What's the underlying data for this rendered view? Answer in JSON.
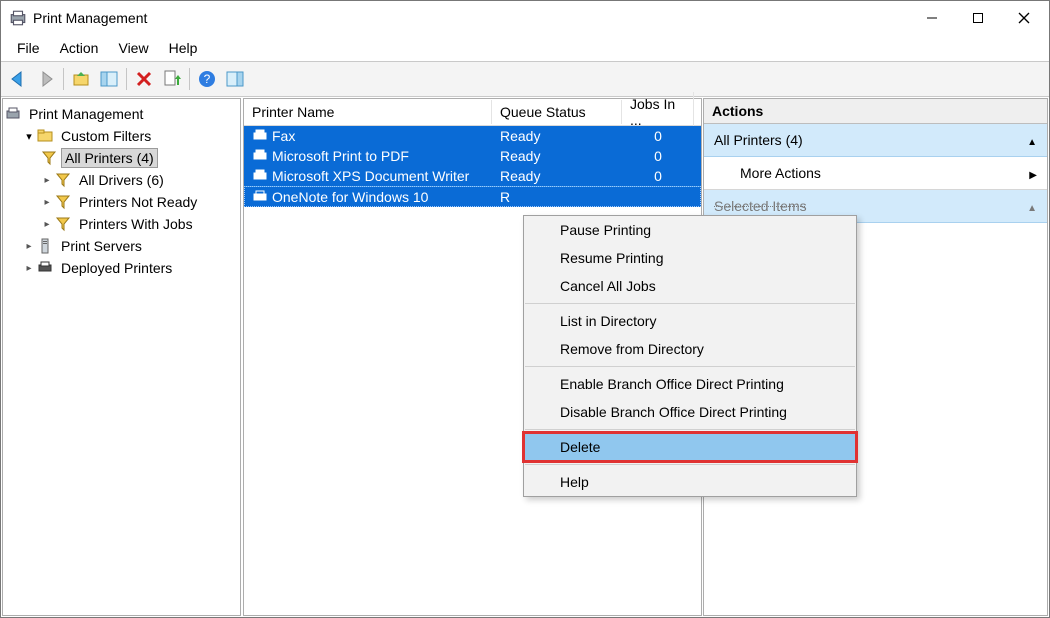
{
  "window": {
    "title": "Print Management"
  },
  "menu": {
    "items": [
      "File",
      "Action",
      "View",
      "Help"
    ]
  },
  "tree": {
    "root": "Print Management",
    "custom_filters": "Custom Filters",
    "filters": [
      {
        "label": "All Printers (4)",
        "selected": true
      },
      {
        "label": "All Drivers (6)",
        "selected": false
      },
      {
        "label": "Printers Not Ready",
        "selected": false
      },
      {
        "label": "Printers With Jobs",
        "selected": false
      }
    ],
    "print_servers": "Print Servers",
    "deployed_printers": "Deployed Printers"
  },
  "list": {
    "columns": [
      "Printer Name",
      "Queue Status",
      "Jobs In ..."
    ],
    "rows": [
      {
        "name": "Fax",
        "status": "Ready",
        "jobs": "0",
        "state": "selected"
      },
      {
        "name": "Microsoft Print to PDF",
        "status": "Ready",
        "jobs": "0",
        "state": "selected"
      },
      {
        "name": "Microsoft XPS Document Writer",
        "status": "Ready",
        "jobs": "0",
        "state": "selected"
      },
      {
        "name": "OneNote for Windows 10",
        "status": "R",
        "jobs": "",
        "state": "dotted"
      }
    ]
  },
  "actions": {
    "header": "Actions",
    "group": "All Printers (4)",
    "more": "More Actions",
    "selected": "Selected Items"
  },
  "context": {
    "pause": "Pause Printing",
    "resume": "Resume Printing",
    "cancel": "Cancel All Jobs",
    "list_dir": "List in Directory",
    "remove_dir": "Remove from Directory",
    "enable_branch": "Enable Branch Office Direct Printing",
    "disable_branch": "Disable Branch Office Direct Printing",
    "delete": "Delete",
    "help": "Help"
  }
}
